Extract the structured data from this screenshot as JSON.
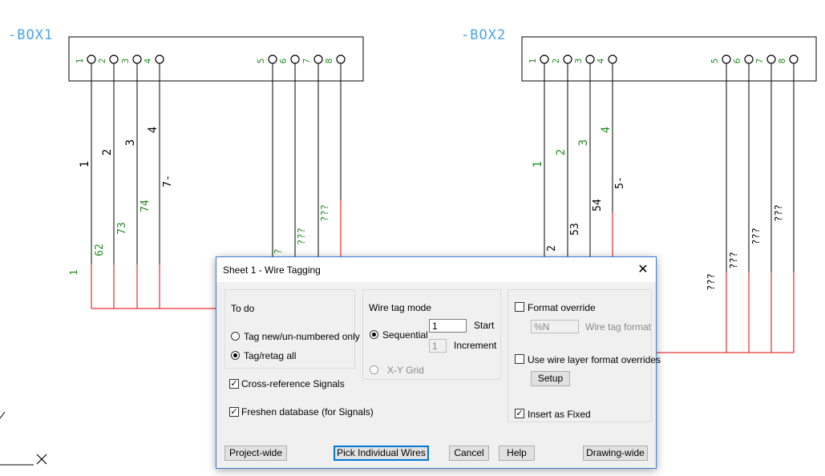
{
  "drawing": {
    "box1": {
      "label": "-BOX1",
      "left_terminals": [
        "1",
        "2",
        "3",
        "4"
      ],
      "right_terminals": [
        "5",
        "6",
        "7",
        "8"
      ],
      "wire_tags": [
        "1",
        "2",
        "3",
        "4"
      ],
      "xref": [
        "62",
        "73",
        "74",
        "7-"
      ],
      "extra_tag": "1",
      "right_tags": [
        "?",
        "???",
        "???"
      ]
    },
    "box2": {
      "label": "-BOX2",
      "left_terminals": [
        "1",
        "2",
        "3",
        "4"
      ],
      "right_terminals": [
        "5",
        "6",
        "7",
        "8"
      ],
      "wire_tags": [
        "1",
        "2",
        "3",
        "4"
      ],
      "xref": [
        "2",
        "53",
        "54",
        "5-"
      ],
      "right_tags": [
        "???",
        "???",
        "???",
        "???"
      ]
    }
  },
  "dialog": {
    "title": "Sheet 1 - Wire Tagging",
    "close_glyph": "✕",
    "todo": {
      "heading": "To do",
      "tag_new": "Tag new/un-numbered only",
      "tag_all": "Tag/retag all",
      "selected": "Tag/retag all"
    },
    "cross_reference": {
      "label": "Cross-reference Signals",
      "checked": true
    },
    "freshen": {
      "label": "Freshen database (for Signals)",
      "checked": true
    },
    "mode": {
      "heading": "Wire tag mode",
      "sequential": "Sequential",
      "xy_grid": "X-Y Grid",
      "selected": "Sequential",
      "start_value": "1",
      "start_label": "Start",
      "increment_value": "1",
      "increment_label": "Increment"
    },
    "format": {
      "override_label": "Format override",
      "override_checked": false,
      "format_value": "%N",
      "format_label": "Wire tag format",
      "layer_label": "Use wire layer format overrides",
      "layer_checked": false,
      "setup_label": "Setup",
      "fixed_label": "Insert as Fixed",
      "fixed_checked": true
    },
    "buttons": {
      "project_wide": "Project-wide",
      "pick": "Pick Individual Wires",
      "cancel": "Cancel",
      "help": "Help",
      "drawing_wide": "Drawing-wide"
    }
  },
  "colors": {
    "wire": "#000000",
    "red_wire": "#e60000",
    "green_tag": "#1f8f1f",
    "accent": "#4aa3e8"
  }
}
